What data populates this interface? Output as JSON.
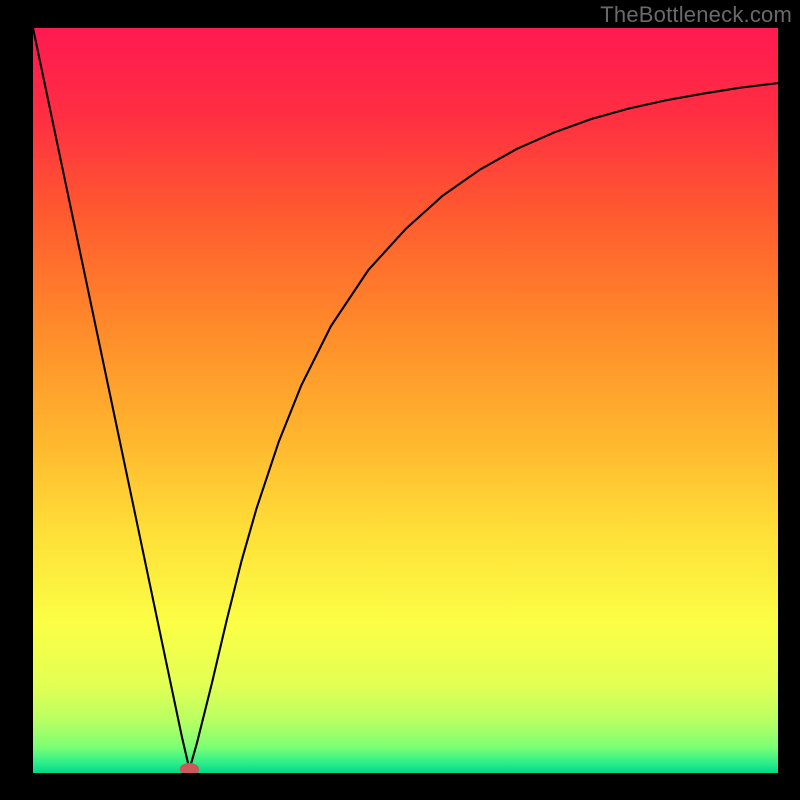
{
  "watermark": "TheBottleneck.com",
  "chart_data": {
    "type": "line",
    "title": "",
    "xlabel": "",
    "ylabel": "",
    "xlim": [
      0,
      100
    ],
    "ylim": [
      0,
      100
    ],
    "grid": false,
    "min_marker": {
      "x": 21,
      "y": 0.5,
      "color": "#c85a5a"
    },
    "series": [
      {
        "name": "curve",
        "x": [
          0,
          5,
          10,
          15,
          18,
          20,
          21,
          22,
          24,
          26,
          28,
          30,
          33,
          36,
          40,
          45,
          50,
          55,
          60,
          65,
          70,
          75,
          80,
          85,
          90,
          95,
          100
        ],
        "y": [
          100,
          76.2,
          52.4,
          28.6,
          14.3,
          4.8,
          0.5,
          4.0,
          12.0,
          20.5,
          28.5,
          35.5,
          44.5,
          52.0,
          60.0,
          67.5,
          73.0,
          77.5,
          81.0,
          83.8,
          86.0,
          87.8,
          89.2,
          90.3,
          91.2,
          92.0,
          92.6
        ]
      }
    ],
    "background": {
      "type": "vertical_gradient",
      "stops": [
        {
          "offset": 0.0,
          "color": "#ff1951"
        },
        {
          "offset": 0.12,
          "color": "#ff2f42"
        },
        {
          "offset": 0.25,
          "color": "#ff5a2f"
        },
        {
          "offset": 0.4,
          "color": "#ff8a2a"
        },
        {
          "offset": 0.55,
          "color": "#ffb62e"
        },
        {
          "offset": 0.68,
          "color": "#ffe038"
        },
        {
          "offset": 0.8,
          "color": "#fbff45"
        },
        {
          "offset": 0.88,
          "color": "#e4ff54"
        },
        {
          "offset": 0.93,
          "color": "#b8ff63"
        },
        {
          "offset": 0.965,
          "color": "#7cff74"
        },
        {
          "offset": 0.985,
          "color": "#33ef8a"
        },
        {
          "offset": 1.0,
          "color": "#00d98b"
        }
      ]
    }
  }
}
